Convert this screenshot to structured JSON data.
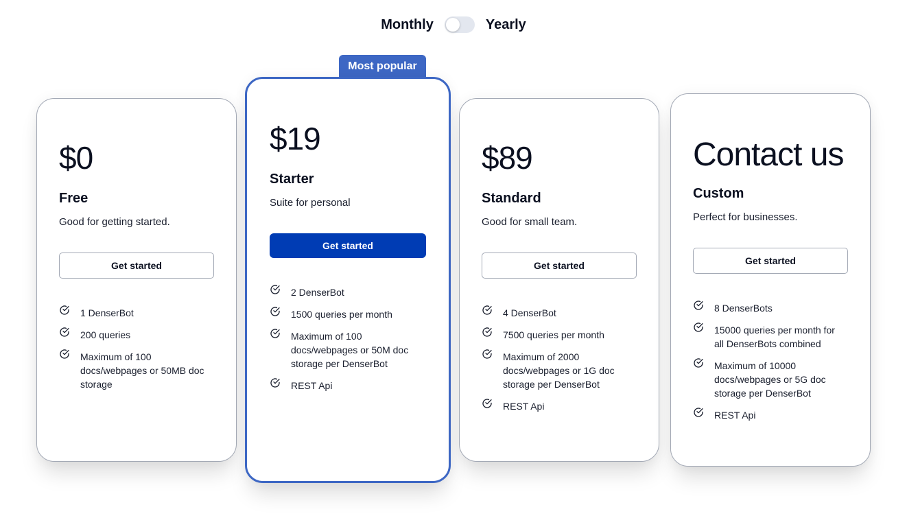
{
  "billing": {
    "monthly_label": "Monthly",
    "yearly_label": "Yearly",
    "selected": "Monthly"
  },
  "badge": "Most popular",
  "colors": {
    "accent": "#3d67c4",
    "primary_button": "#003cb4",
    "border": "#a3a9b5",
    "text": "#0b1020"
  },
  "plans": [
    {
      "price": "$0",
      "name": "Free",
      "description": "Good for getting started.",
      "cta": "Get started",
      "features": [
        "1 DenserBot",
        "200 queries",
        "Maximum of 100 docs/webpages or 50MB doc storage"
      ]
    },
    {
      "price": "$19",
      "name": "Starter",
      "description": "Suite for personal",
      "cta": "Get started",
      "features": [
        "2 DenserBot",
        "1500 queries per month",
        "Maximum of 100 docs/webpages or 50M doc storage per DenserBot",
        "REST Api"
      ]
    },
    {
      "price": "$89",
      "name": "Standard",
      "description": "Good for small team.",
      "cta": "Get started",
      "features": [
        "4 DenserBot",
        "7500 queries per month",
        "Maximum of 2000 docs/webpages or 1G doc storage per DenserBot",
        "REST Api"
      ]
    },
    {
      "price": "Contact us",
      "name": "Custom",
      "description": "Perfect for businesses.",
      "cta": "Get started",
      "features": [
        "8 DenserBots",
        "15000 queries per month for all DenserBots combined",
        "Maximum of 10000 docs/webpages or 5G doc storage per DenserBot",
        "REST Api"
      ]
    }
  ]
}
